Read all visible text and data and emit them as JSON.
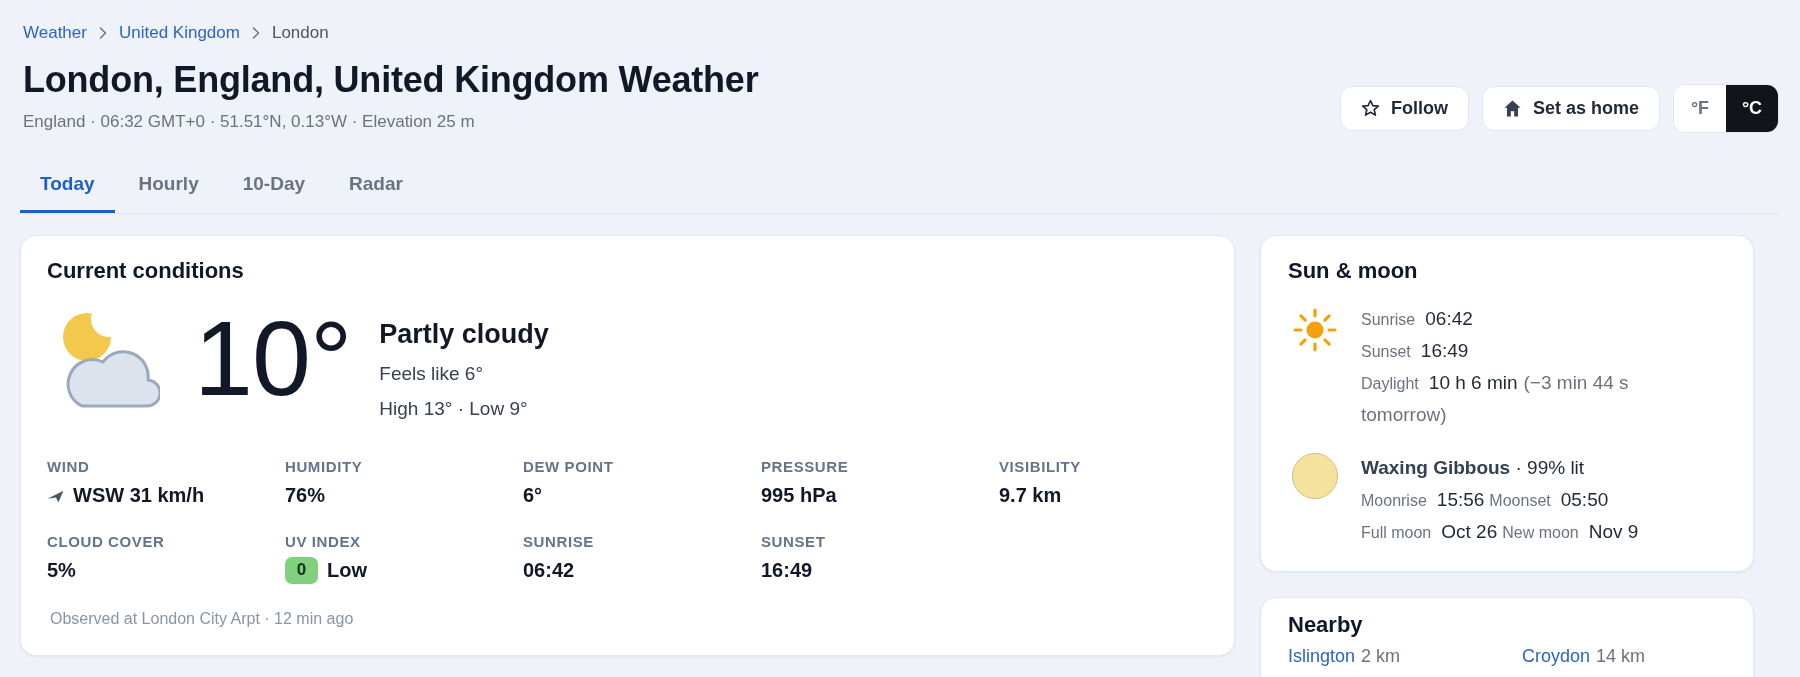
{
  "breadcrumb": [
    {
      "label": "Weather",
      "current": false
    },
    {
      "label": "United Kingdom",
      "current": false
    },
    {
      "label": "London",
      "current": true
    }
  ],
  "title": "London, England, United Kingdom Weather",
  "meta": "England · 06:32 GMT+0 · 51.51°N, 0.13°W · Elevation 25 m",
  "actions": [
    {
      "kind": "follow",
      "label": "Follow"
    },
    {
      "kind": "home",
      "label": "Set as home"
    }
  ],
  "units": [
    {
      "label": "°F",
      "selected": false
    },
    {
      "label": "°C",
      "selected": true
    }
  ],
  "tabs": [
    {
      "label": "Today",
      "selected": true
    },
    {
      "label": "Hourly",
      "selected": false
    },
    {
      "label": "10-Day",
      "selected": false
    },
    {
      "label": "Radar",
      "selected": false
    }
  ],
  "current": {
    "title": "Current conditions",
    "temperature": "10°",
    "condition": "Partly cloudy",
    "feels_like": "Feels like 6°",
    "high_low": "High 13° · Low 9°",
    "stats": [
      {
        "kind": "wind",
        "label": "WIND",
        "value": "WSW 31 km/h"
      },
      {
        "kind": "plain",
        "label": "HUMIDITY",
        "value": "76%"
      },
      {
        "kind": "plain",
        "label": "DEW POINT",
        "value": "6°"
      },
      {
        "kind": "plain",
        "label": "PRESSURE",
        "value": "995 hPa"
      },
      {
        "kind": "plain",
        "label": "VISIBILITY",
        "value": "9.7 km"
      },
      {
        "kind": "plain",
        "label": "CLOUD COVER",
        "value": "5%"
      },
      {
        "kind": "uv",
        "label": "UV INDEX",
        "index": "0",
        "value": "Low",
        "color": "#80d07e"
      },
      {
        "kind": "plain",
        "label": "SUNRISE",
        "value": "06:42"
      },
      {
        "kind": "plain",
        "label": "SUNSET",
        "value": "16:49"
      }
    ],
    "observed": "Observed at London City Arpt · 12 min ago"
  },
  "sun_moon": {
    "title": "Sun & moon",
    "sun": [
      {
        "label": "Sunrise",
        "value": "06:42"
      },
      {
        "label": "Sunset",
        "value": "16:49"
      },
      {
        "label": "Daylight",
        "value": "10 h 6 min",
        "note": "(−3 min 44 s tomorrow)"
      }
    ],
    "moon": {
      "phase": "**Waxing Gibbous** · 99% lit",
      "rows": [
        {
          "items": [
            {
              "label": "Moonrise",
              "value": "15:56"
            },
            {
              "label": "Moonset",
              "value": "05:50"
            }
          ]
        },
        {
          "items": [
            {
              "label": "Full moon",
              "value": "Oct 26"
            },
            {
              "label": "New moon",
              "value": "Nov 9"
            }
          ]
        }
      ]
    }
  },
  "nearby": {
    "title": "Nearby",
    "places": [
      {
        "name": "Islington",
        "distance": "2 km"
      },
      {
        "name": "Croydon",
        "distance": "14 km"
      }
    ]
  }
}
